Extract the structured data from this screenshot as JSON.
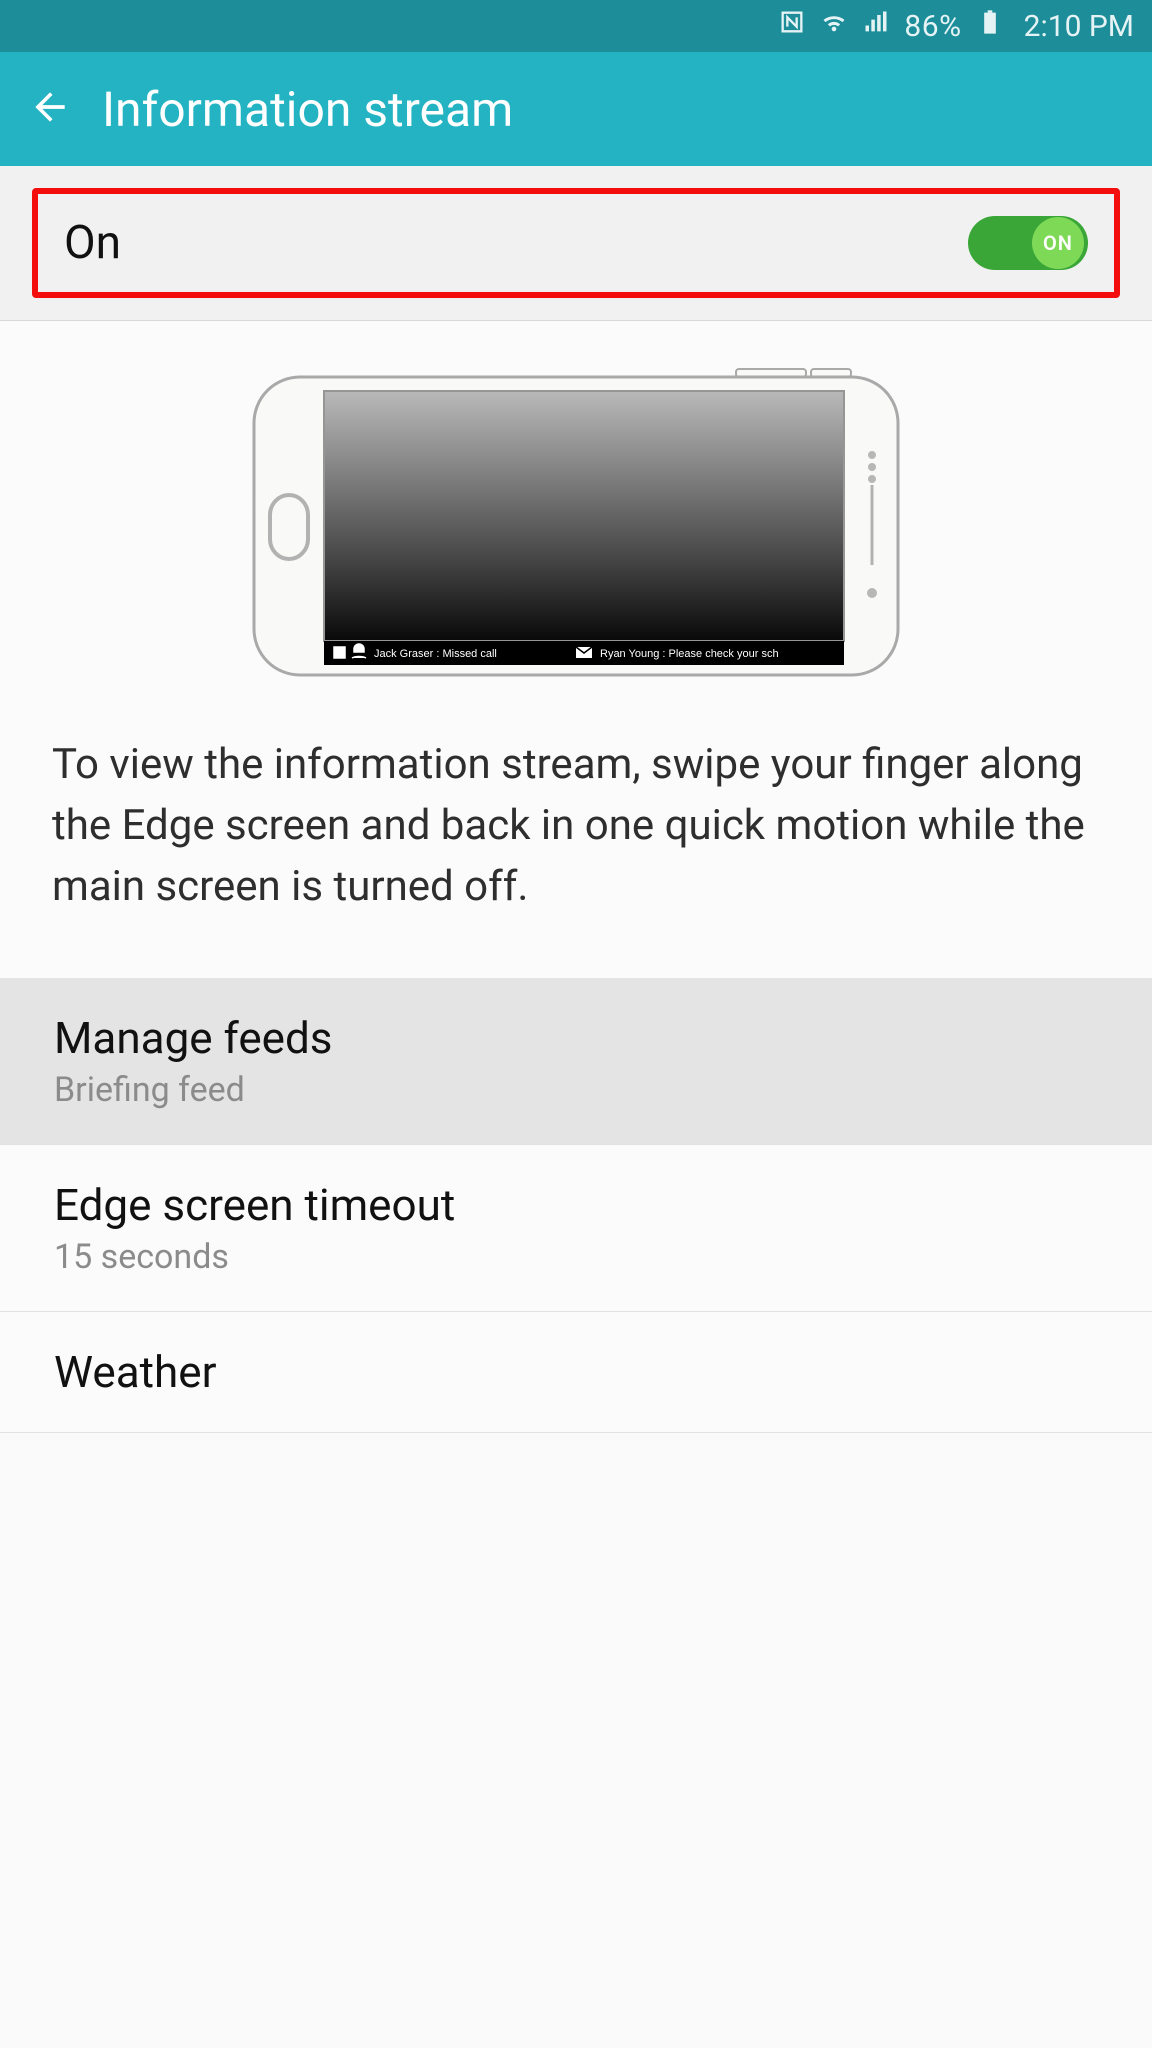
{
  "status": {
    "battery_pct": "86%",
    "time": "2:10 PM"
  },
  "appbar": {
    "title": "Information stream"
  },
  "toggle": {
    "label": "On",
    "state_text": "ON"
  },
  "ticker": {
    "item1": "Jack Graser : Missed call",
    "item2": "Ryan Young : Please check your sch"
  },
  "description": "To view the information stream, swipe your finger along the Edge screen and back in one quick motion while the main screen is turned off.",
  "settings": [
    {
      "title": "Manage feeds",
      "sub": "Briefing feed"
    },
    {
      "title": "Edge screen timeout",
      "sub": "15 seconds"
    },
    {
      "title": "Weather",
      "sub": ""
    }
  ]
}
